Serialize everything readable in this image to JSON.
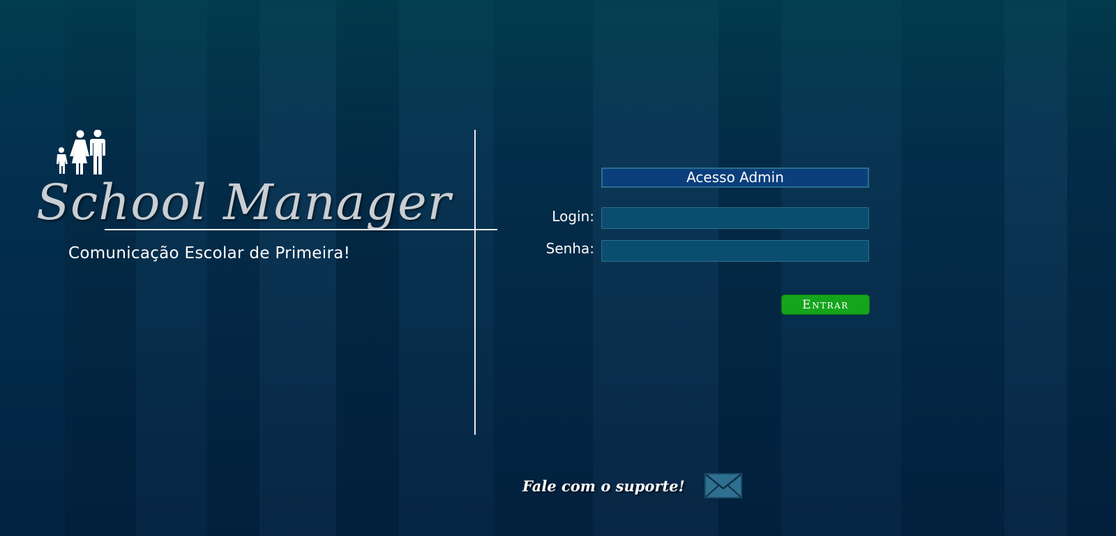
{
  "brand": {
    "title": "School Manager",
    "tagline": "Comunicação Escolar de Primeira!",
    "logo_icon": "family-icon"
  },
  "login_form": {
    "header": "Acesso Admin",
    "login_label": "Login:",
    "login_value": "",
    "password_label": "Senha:",
    "password_value": "",
    "submit_label": "Entrar",
    "submit_color": "#14a51c"
  },
  "support": {
    "label": "Fale com o suporte!",
    "icon": "envelope-icon"
  },
  "colors": {
    "background": "#03304f",
    "header_fill": "#0a3f7c",
    "field_fill": "#0a4d6e"
  }
}
